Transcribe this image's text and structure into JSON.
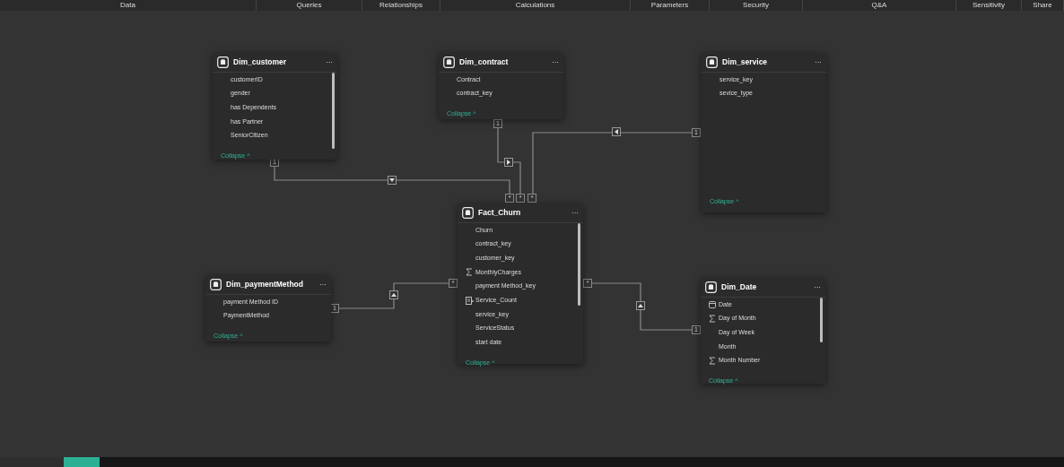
{
  "ribbon_tabs": [
    "Data",
    "Queries",
    "Relationships",
    "Calculations",
    "Parameters",
    "Security",
    "Q&A",
    "Sensitivity",
    "Share"
  ],
  "tables": [
    {
      "title": "Dim_customer",
      "fields": [
        {
          "name": "customerID",
          "kind": "text"
        },
        {
          "name": "gender",
          "kind": "text"
        },
        {
          "name": "has Dependents",
          "kind": "text"
        },
        {
          "name": "has Partner",
          "kind": "text"
        },
        {
          "name": "SeniorCitizen",
          "kind": "text"
        }
      ],
      "menu": "···",
      "collapse": "Collapse ^"
    },
    {
      "title": "Dim_contract",
      "fields": [
        {
          "name": "Contract",
          "kind": "text"
        },
        {
          "name": "contract_key",
          "kind": "text"
        }
      ],
      "menu": "···",
      "collapse": "Collapse ^"
    },
    {
      "title": "Dim_service",
      "fields": [
        {
          "name": "service_key",
          "kind": "text"
        },
        {
          "name": "sevice_type",
          "kind": "text"
        }
      ],
      "menu": "···",
      "collapse": "Collapse ^"
    },
    {
      "title": "Fact_Churn",
      "fields": [
        {
          "name": "Churn",
          "kind": "text"
        },
        {
          "name": "contract_key",
          "kind": "text"
        },
        {
          "name": "customer_key",
          "kind": "text"
        },
        {
          "name": "MonthlyCharges",
          "kind": "sum"
        },
        {
          "name": "payment Method_key",
          "kind": "text"
        },
        {
          "name": "Service_Count",
          "kind": "calc"
        },
        {
          "name": "service_key",
          "kind": "text"
        },
        {
          "name": "ServiceStatus",
          "kind": "text"
        },
        {
          "name": "start date",
          "kind": "text"
        }
      ],
      "menu": "···",
      "collapse": "Collapse ^"
    },
    {
      "title": "Dim_paymentMethod",
      "fields": [
        {
          "name": "payment Method ID",
          "kind": "text"
        },
        {
          "name": "PaymentMethod",
          "kind": "text"
        }
      ],
      "menu": "···",
      "collapse": "Collapse ^"
    },
    {
      "title": "Dim_Date",
      "fields": [
        {
          "name": "Date",
          "kind": "date"
        },
        {
          "name": "Day of Month",
          "kind": "sum"
        },
        {
          "name": "Day of Week",
          "kind": "text"
        },
        {
          "name": "Month",
          "kind": "text"
        },
        {
          "name": "Month Number",
          "kind": "sum"
        }
      ],
      "menu": "···",
      "collapse": "Collapse ^"
    }
  ],
  "relationships": [
    {
      "one": "1",
      "many": "*"
    },
    {
      "one": "1",
      "many": "*"
    },
    {
      "one": "1",
      "many": "*"
    },
    {
      "one": "1",
      "many": "*"
    },
    {
      "one": "1",
      "many": "*"
    }
  ]
}
